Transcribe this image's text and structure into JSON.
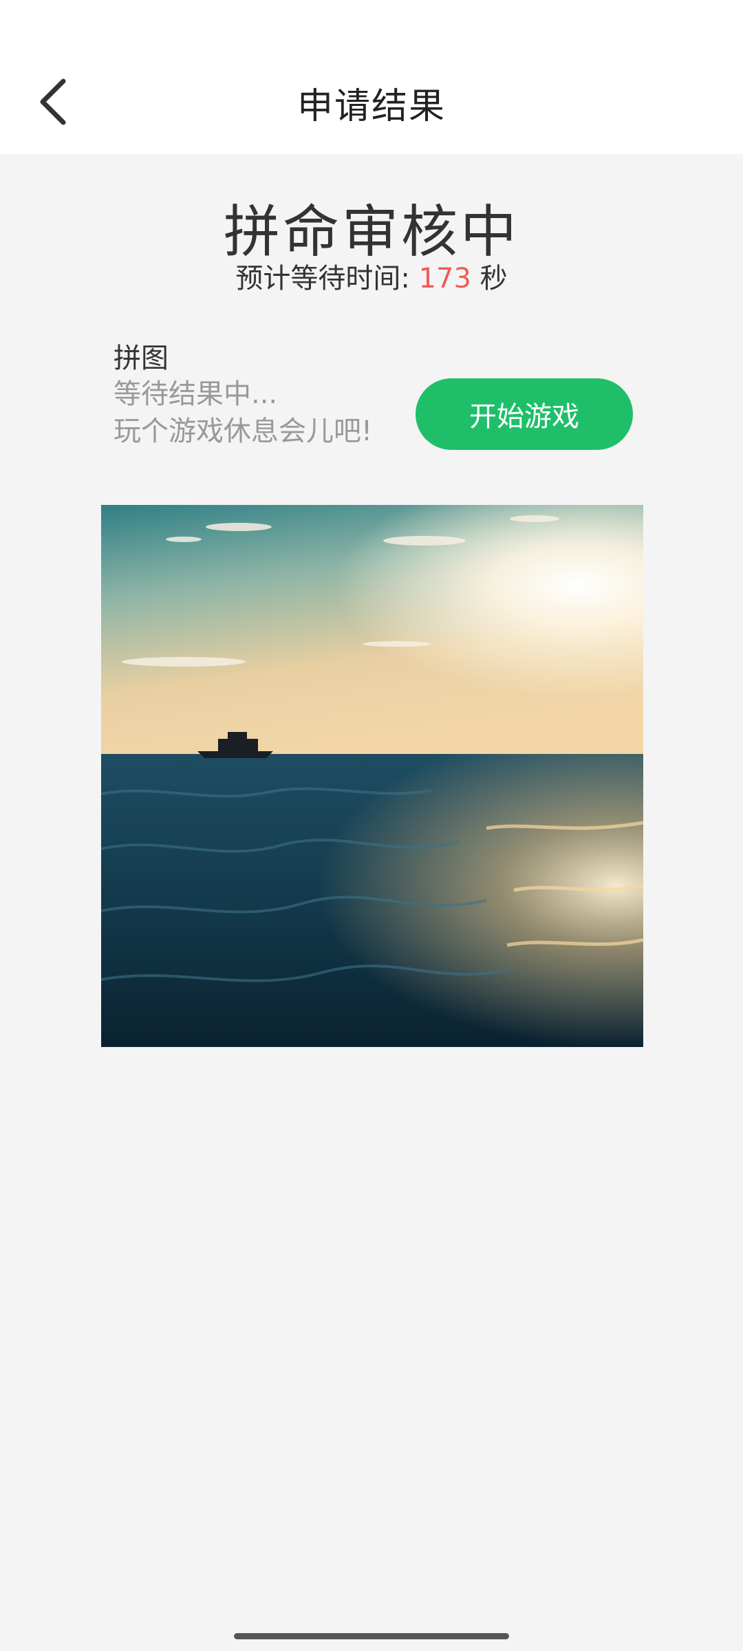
{
  "header": {
    "title": "申请结果",
    "back_icon": "chevron-left-icon"
  },
  "status": {
    "title": "拼命审核中",
    "wait_prefix": "预计等待时间:",
    "wait_seconds": "173",
    "wait_unit": "秒",
    "seconds_color": "#f25a5a"
  },
  "game": {
    "name": "拼图",
    "line1": "等待结果中...",
    "line2": "玩个游戏休息会儿吧!",
    "start_label": "开始游戏",
    "button_color": "#1fbf6a"
  },
  "puzzle_image": {
    "subject": "sunset over ocean with boat silhouette"
  }
}
